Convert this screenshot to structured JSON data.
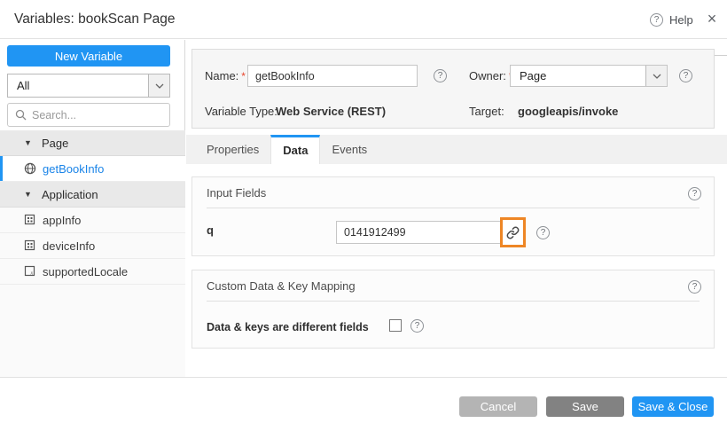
{
  "colors": {
    "accent_blue": "#2095f3",
    "highlight_orange": "#ee8625",
    "selected_text_blue": "#1a84e8"
  },
  "icons": {
    "question_glyph": "?",
    "caret_down_glyph": "▼",
    "close_glyph": "×"
  },
  "header": {
    "title": "Variables: bookScan Page",
    "help_label": "Help"
  },
  "sidebar": {
    "new_variable_label": "New Variable",
    "filter_value": "All",
    "search_placeholder": "Search...",
    "tree": [
      {
        "type": "group",
        "label": "Page"
      },
      {
        "type": "item",
        "label": "getBookInfo",
        "selected": true,
        "icon": "web-service"
      },
      {
        "type": "group",
        "label": "Application"
      },
      {
        "type": "item",
        "label": "appInfo",
        "icon": "object"
      },
      {
        "type": "item",
        "label": "deviceInfo",
        "icon": "object"
      },
      {
        "type": "item",
        "label": "supportedLocale",
        "icon": "locale"
      }
    ]
  },
  "info": {
    "name_label": "Name:",
    "required_mark": "*",
    "name_value": "getBookInfo",
    "owner_label": "Owner:",
    "owner_value": "Page",
    "type_label": "Variable Type:",
    "type_value": "Web Service (REST)",
    "target_label": "Target:",
    "target_value": "googleapis/invoke"
  },
  "tabs": {
    "items": [
      {
        "label": "Properties",
        "active": false
      },
      {
        "label": "Data",
        "active": true
      },
      {
        "label": "Events",
        "active": false
      }
    ]
  },
  "input_fields": {
    "title": "Input Fields",
    "field_label": "q",
    "field_value": "0141912499"
  },
  "custom_mapping": {
    "title": "Custom Data & Key Mapping",
    "checkbox_label": "Data & keys are different fields",
    "checkbox_checked": false
  },
  "footer": {
    "cancel_label": "Cancel",
    "save_label": "Save",
    "save_close_label": "Save & Close"
  }
}
